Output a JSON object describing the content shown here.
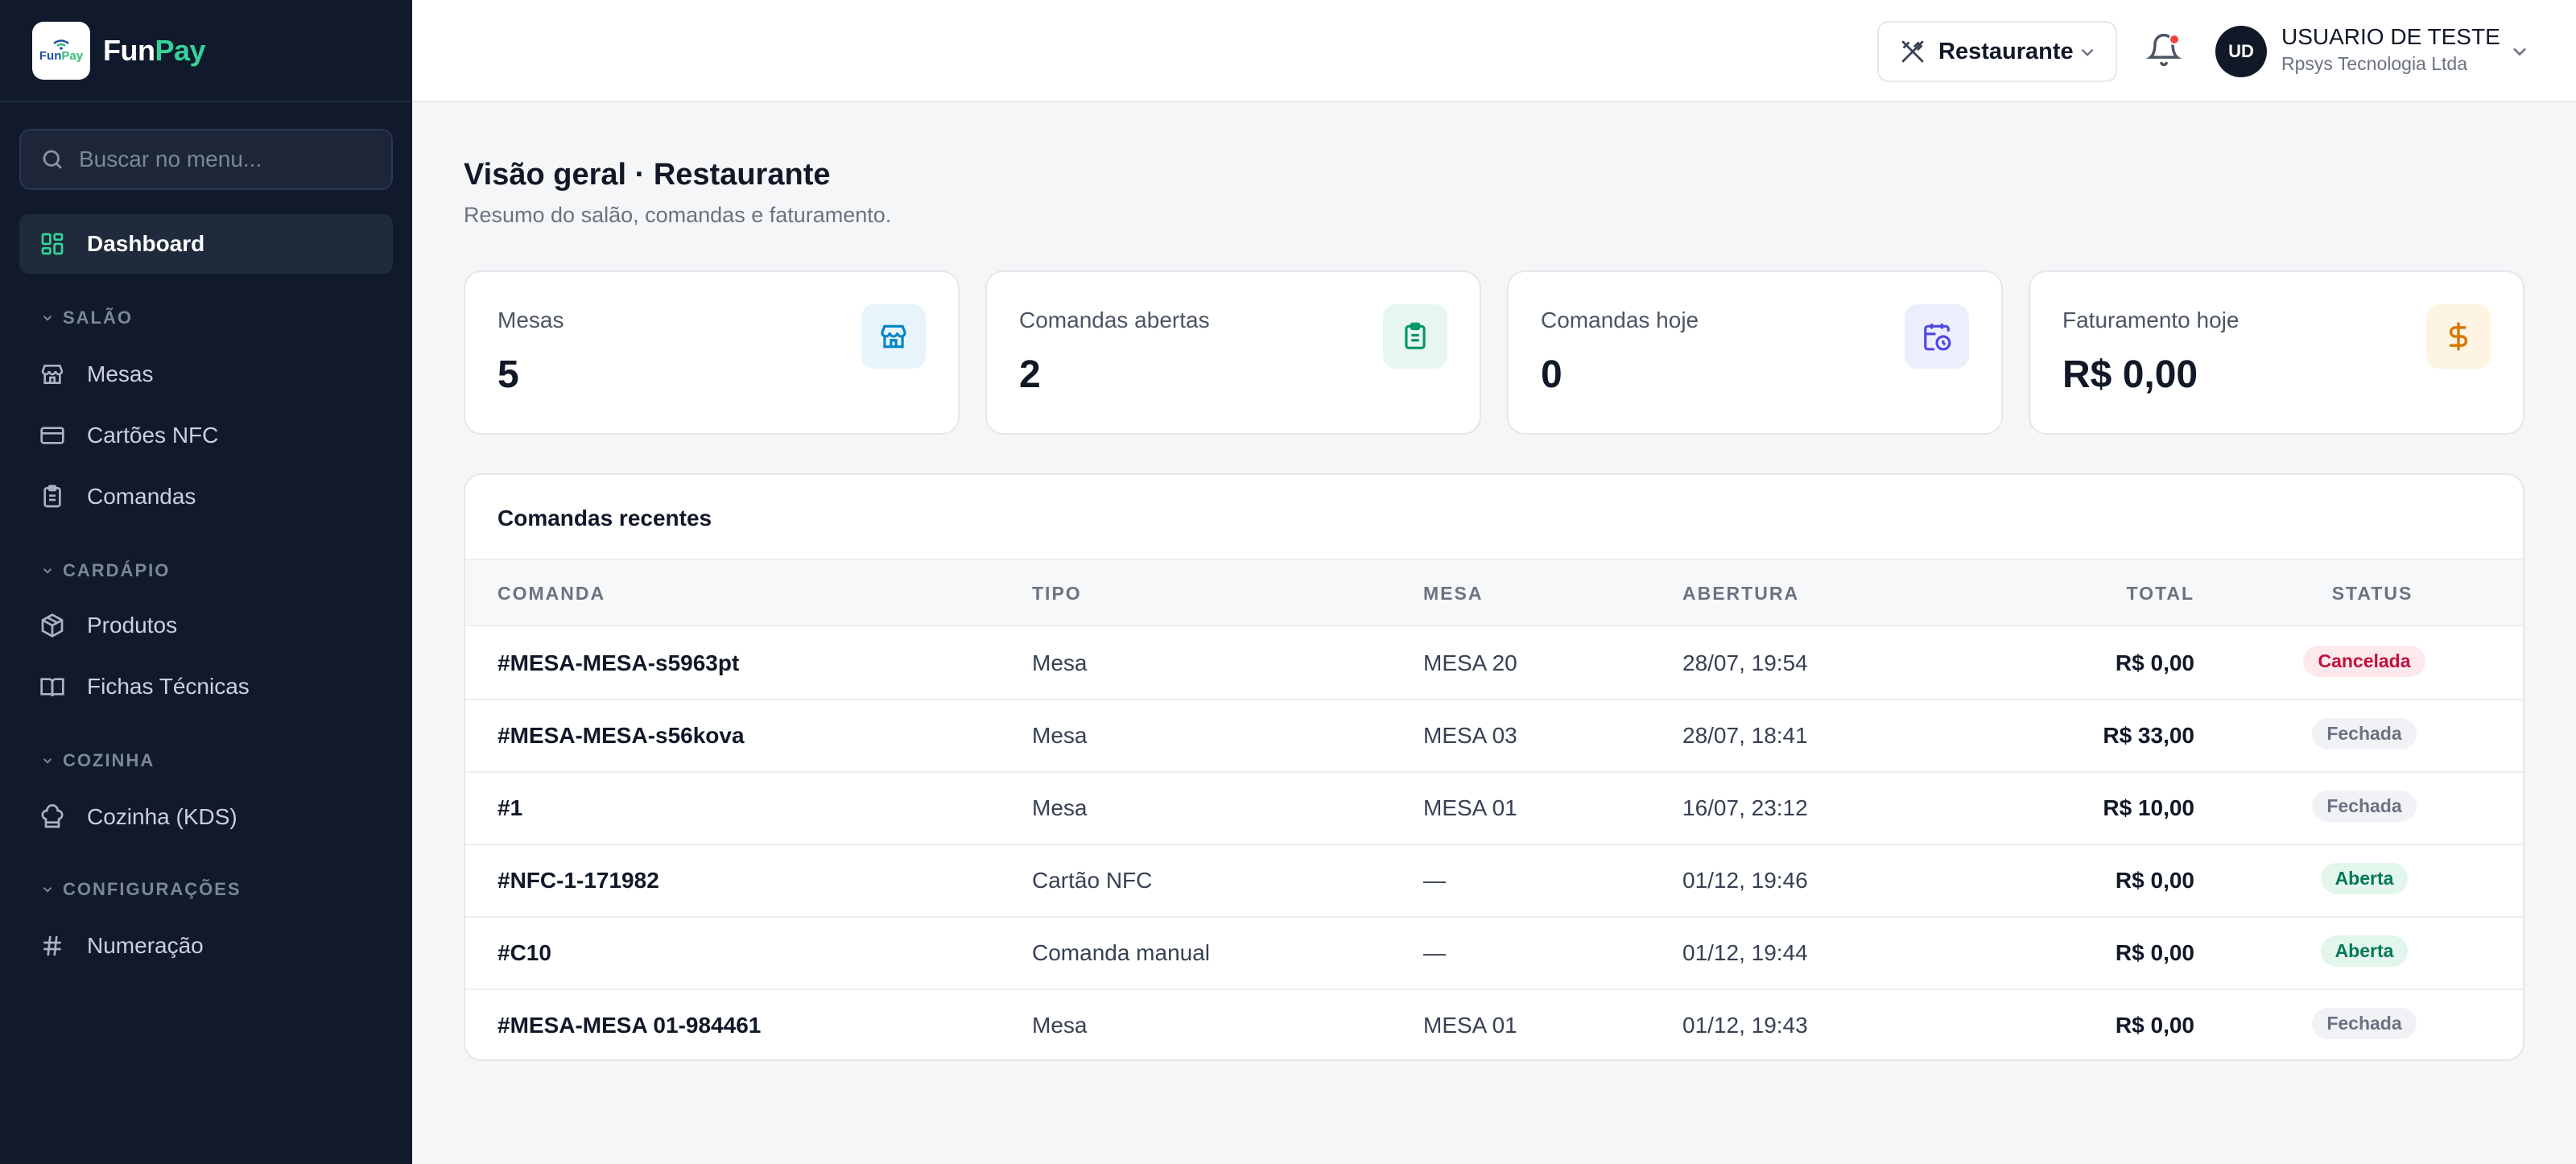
{
  "brand": {
    "logo_text_a": "Fun",
    "logo_text_b": "Pay",
    "name_a": "Fun",
    "name_b": "Pay"
  },
  "search": {
    "placeholder": "Buscar no menu..."
  },
  "sidebar": {
    "dashboard": "Dashboard",
    "sections": [
      {
        "title": "SALÃO",
        "items": [
          "Mesas",
          "Cartões NFC",
          "Comandas"
        ]
      },
      {
        "title": "CARDÁPIO",
        "items": [
          "Produtos",
          "Fichas Técnicas"
        ]
      },
      {
        "title": "COZINHA",
        "items": [
          "Cozinha (KDS)"
        ]
      },
      {
        "title": "CONFIGURAÇÕES",
        "items": [
          "Numeração"
        ]
      }
    ]
  },
  "header": {
    "unit": "Restaurante",
    "avatar_initials": "UD",
    "user_name": "USUARIO DE TESTE",
    "user_org": "Rpsys Tecnologia Ltda"
  },
  "page": {
    "title": "Visão geral · Restaurante",
    "subtitle": "Resumo do salão, comandas e faturamento."
  },
  "stats": [
    {
      "label": "Mesas",
      "value": "5",
      "icon": "store-icon",
      "color": "#0284c7",
      "bg": "#e8f4fb"
    },
    {
      "label": "Comandas abertas",
      "value": "2",
      "icon": "clipboard-icon",
      "color": "#059669",
      "bg": "#e7f7ef"
    },
    {
      "label": "Comandas hoje",
      "value": "0",
      "icon": "calendar-clock-icon",
      "color": "#4f46e5",
      "bg": "#eceefb"
    },
    {
      "label": "Faturamento hoje",
      "value": "R$ 0,00",
      "icon": "dollar-icon",
      "color": "#d97706",
      "bg": "#fdf4e3"
    }
  ],
  "recent": {
    "title": "Comandas recentes",
    "columns": [
      "COMANDA",
      "TIPO",
      "MESA",
      "ABERTURA",
      "TOTAL",
      "STATUS"
    ],
    "rows": [
      {
        "comanda": "#MESA-MESA-s5963pt",
        "tipo": "Mesa",
        "mesa": "MESA 20",
        "abertura": "28/07, 19:54",
        "total": "R$ 0,00",
        "status": "Cancelada"
      },
      {
        "comanda": "#MESA-MESA-s56kova",
        "tipo": "Mesa",
        "mesa": "MESA 03",
        "abertura": "28/07, 18:41",
        "total": "R$ 33,00",
        "status": "Fechada"
      },
      {
        "comanda": "#1",
        "tipo": "Mesa",
        "mesa": "MESA 01",
        "abertura": "16/07, 23:12",
        "total": "R$ 10,00",
        "status": "Fechada"
      },
      {
        "comanda": "#NFC-1-171982",
        "tipo": "Cartão NFC",
        "mesa": "—",
        "abertura": "01/12, 19:46",
        "total": "R$ 0,00",
        "status": "Aberta"
      },
      {
        "comanda": "#C10",
        "tipo": "Comanda manual",
        "mesa": "—",
        "abertura": "01/12, 19:44",
        "total": "R$ 0,00",
        "status": "Aberta"
      },
      {
        "comanda": "#MESA-MESA 01-984461",
        "tipo": "Mesa",
        "mesa": "MESA 01",
        "abertura": "01/12, 19:43",
        "total": "R$ 0,00",
        "status": "Fechada"
      }
    ]
  },
  "status_colors": {
    "Cancelada": {
      "fg": "#be123c",
      "bg": "#fde8ec"
    },
    "Fechada": {
      "fg": "#6b7280",
      "bg": "#f1f2f5"
    },
    "Aberta": {
      "fg": "#047857",
      "bg": "#e3f6ec"
    }
  }
}
